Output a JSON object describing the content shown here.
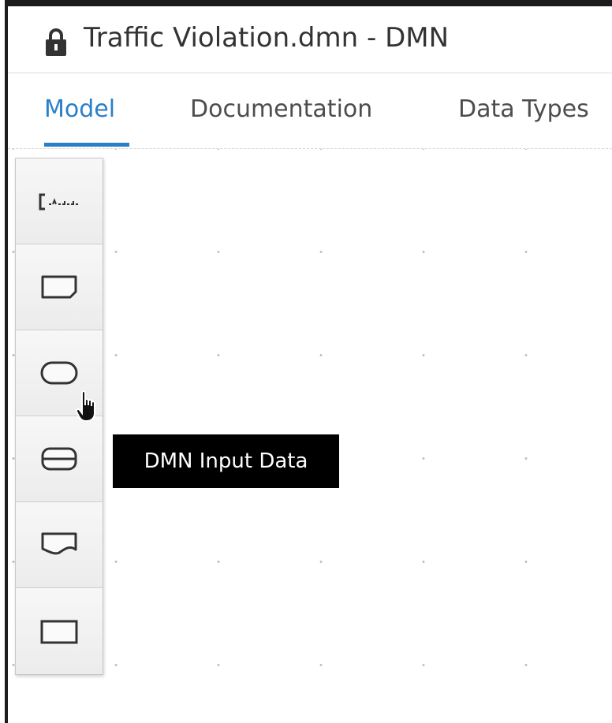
{
  "window": {
    "title": "Traffic Violation.dmn - DMN",
    "title_icon": "lock-icon"
  },
  "tabs": [
    {
      "label": "Model",
      "active": true
    },
    {
      "label": "Documentation",
      "active": false
    },
    {
      "label": "Data Types",
      "active": false
    }
  ],
  "palette": {
    "items": [
      {
        "name": "text-annotation",
        "icon": "text-annotation-icon"
      },
      {
        "name": "decision",
        "icon": "decision-icon"
      },
      {
        "name": "input-data",
        "icon": "input-data-icon"
      },
      {
        "name": "business-knowledge-model",
        "icon": "business-knowledge-model-icon"
      },
      {
        "name": "knowledge-source",
        "icon": "knowledge-source-icon"
      },
      {
        "name": "decision-service",
        "icon": "decision-service-icon"
      }
    ]
  },
  "tooltip": {
    "text": "DMN Input Data"
  },
  "colors": {
    "accent": "#2b7fc9",
    "tooltip_bg": "#000000",
    "palette_bg": "#f1f1f1"
  }
}
